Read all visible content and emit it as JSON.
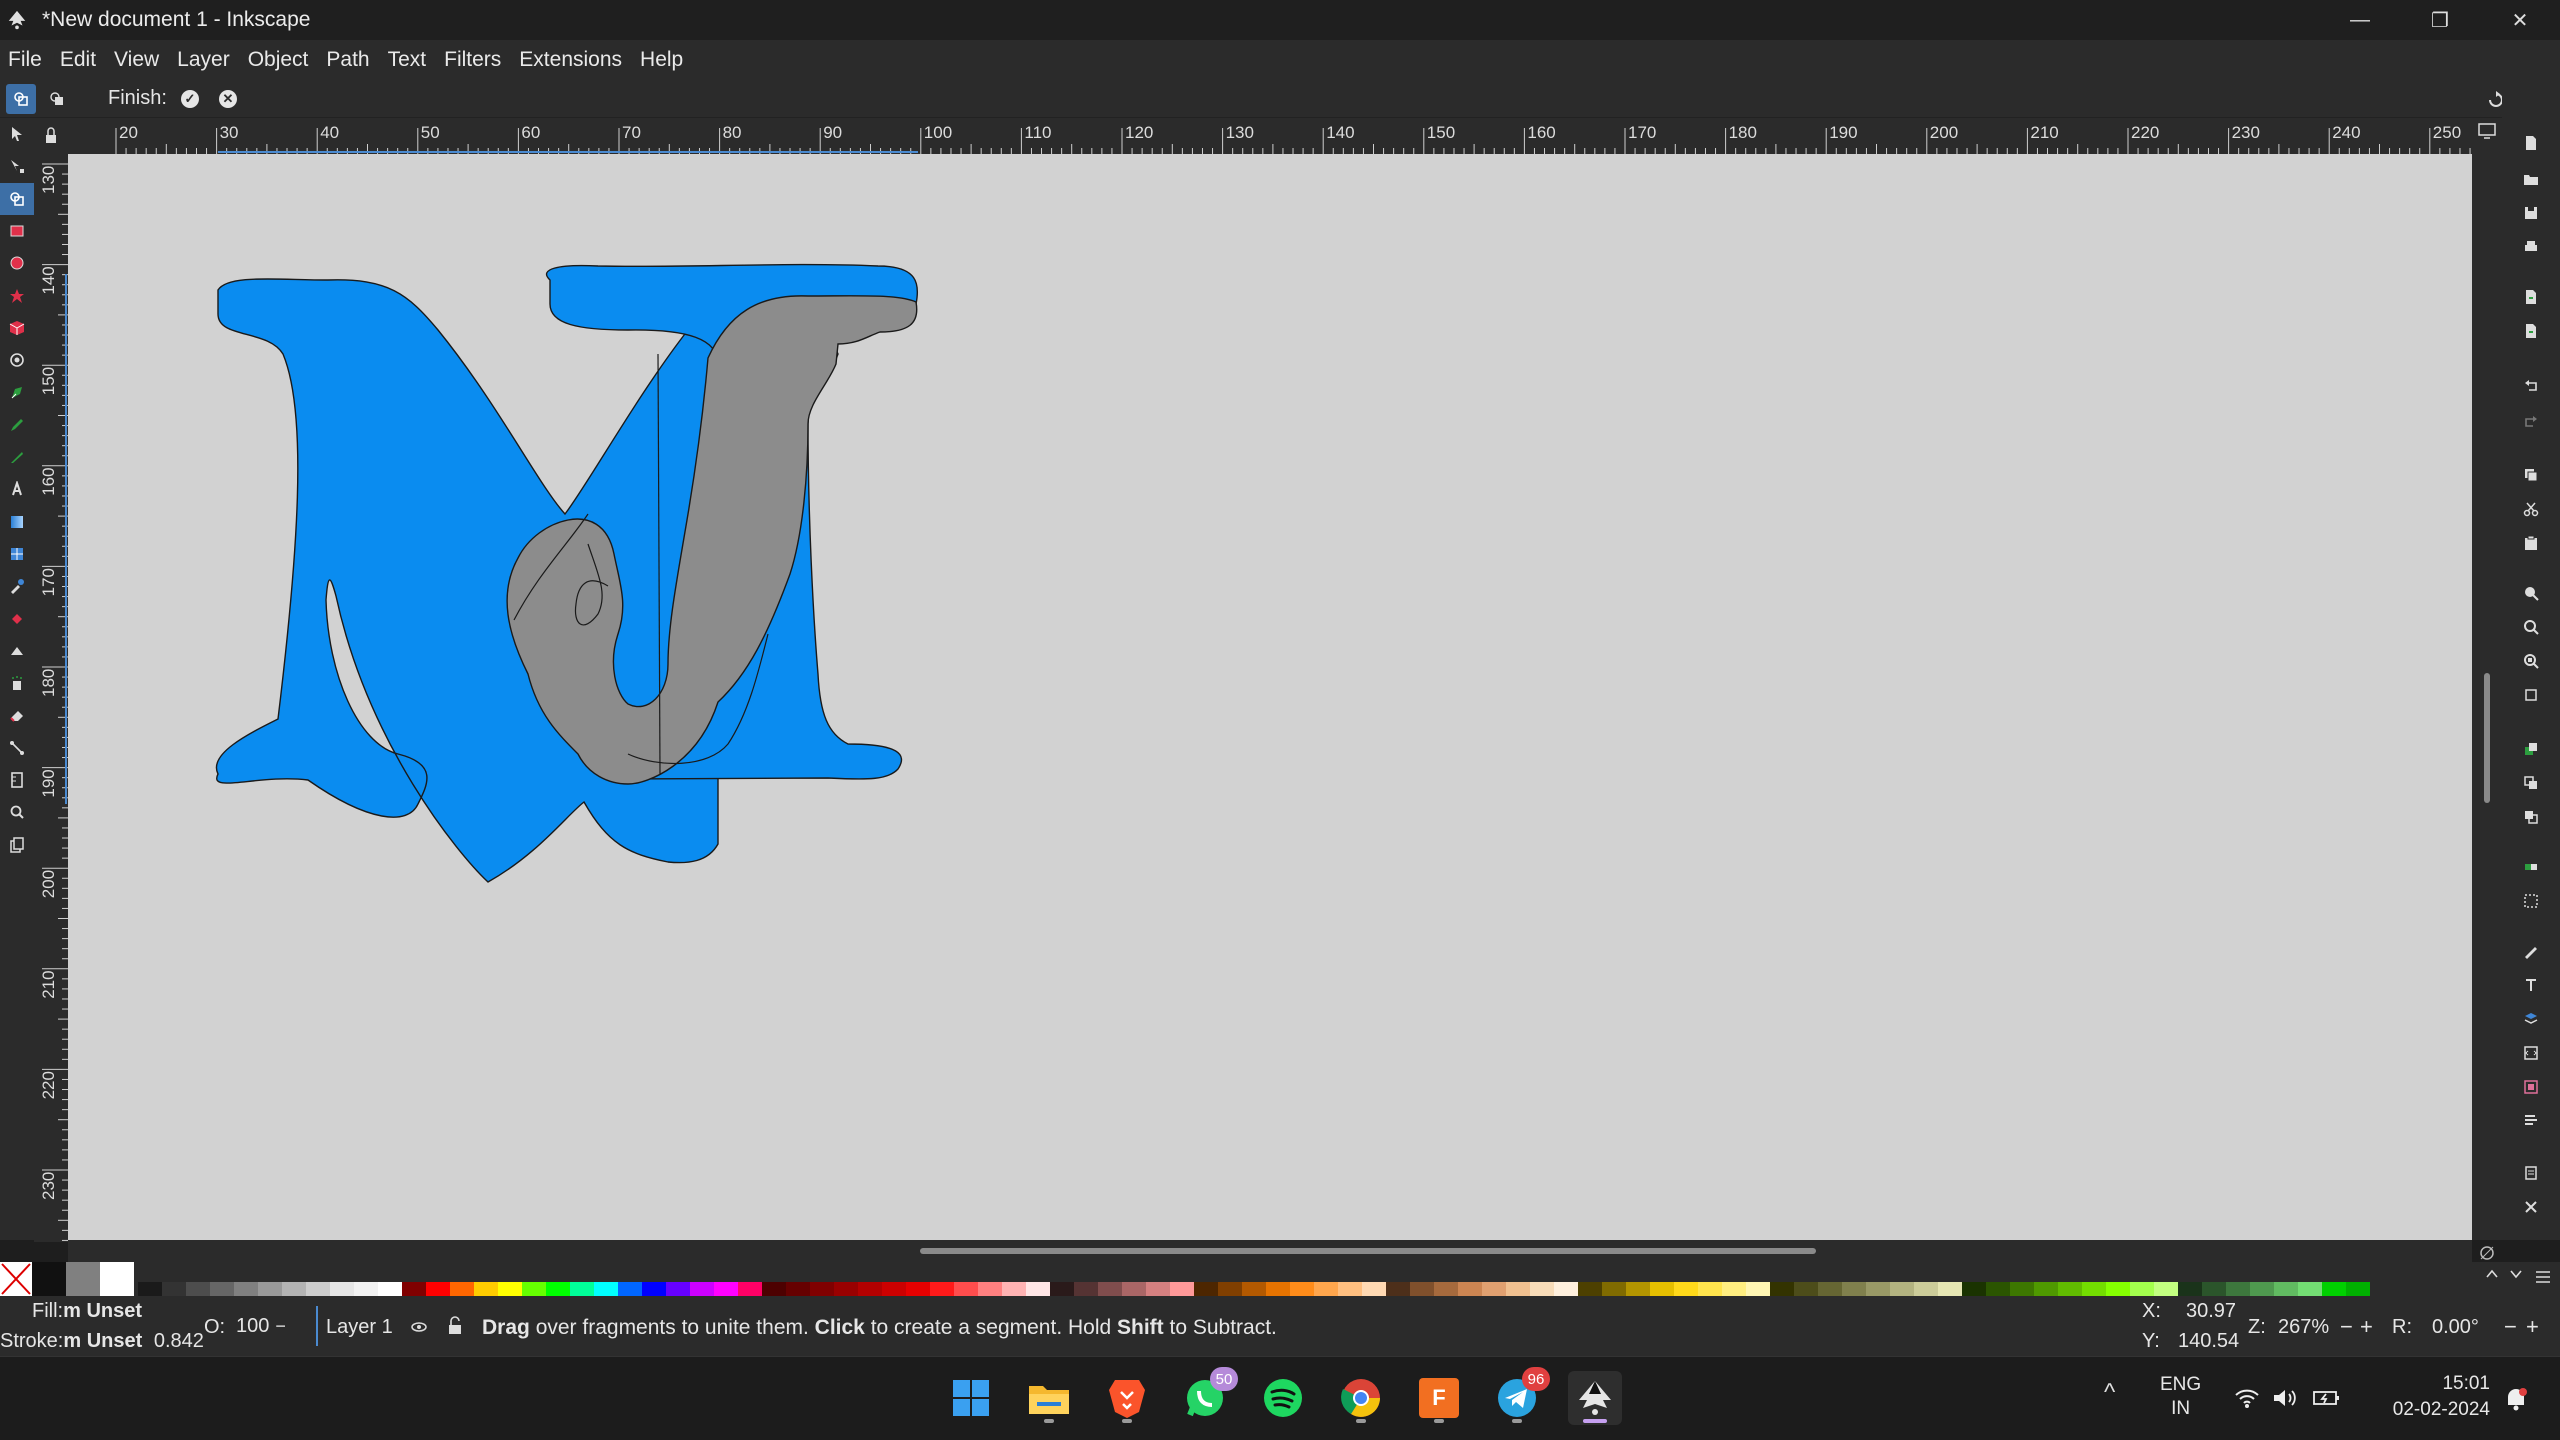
{
  "window": {
    "title": "*New document 1 - Inkscape",
    "minimize": "—",
    "restore": "❐",
    "close": "✕"
  },
  "menu": [
    "File",
    "Edit",
    "View",
    "Layer",
    "Object",
    "Path",
    "Text",
    "Filters",
    "Extensions",
    "Help"
  ],
  "tool_controls": {
    "finish_label": "Finish:",
    "apply_icon": "check-circle-icon",
    "cancel_icon": "cancel-circle-icon"
  },
  "toolbox": [
    "selector",
    "node",
    "shape-builder",
    "rectangle",
    "ellipse",
    "star",
    "3d-box",
    "spiral",
    "pen",
    "pencil",
    "calligraphy",
    "text",
    "gradient",
    "mesh",
    "dropper",
    "paint-bucket",
    "tweak",
    "spray",
    "eraser",
    "connector",
    "measure",
    "zoom",
    "pages"
  ],
  "rulers": {
    "horizontal_ticks": [
      "20",
      "30",
      "40",
      "50",
      "60",
      "70",
      "80",
      "90",
      "100",
      "110",
      "120",
      "130",
      "140",
      "150",
      "160",
      "170",
      "180",
      "190",
      "200",
      "210",
      "220",
      "230",
      "240",
      "250"
    ],
    "vertical_ticks": [
      "130",
      "140",
      "150",
      "160",
      "170",
      "180",
      "190",
      "200",
      "210",
      "220",
      "230"
    ]
  },
  "canvas": {
    "background": "#d2d2d2",
    "shape_colors": {
      "blue": "#0a8cf0",
      "gray": "#8c8c8c"
    }
  },
  "palette": {
    "colors": [
      "#1a1a1a",
      "#333333",
      "#4d4d4d",
      "#666666",
      "#808080",
      "#999999",
      "#b3b3b3",
      "#cccccc",
      "#e6e6e6",
      "#f2f2f2",
      "#ffffff",
      "#800000",
      "#ff0000",
      "#ff6600",
      "#ffcc00",
      "#ffff00",
      "#66ff00",
      "#00ff00",
      "#00ff99",
      "#00ffff",
      "#0066ff",
      "#0000ff",
      "#6600ff",
      "#cc00ff",
      "#ff00ff",
      "#ff0066",
      "#4d0000",
      "#660000",
      "#800000",
      "#990000",
      "#b30000",
      "#cc0000",
      "#e60000",
      "#ff1a1a",
      "#ff4d4d",
      "#ff8080",
      "#ffb3b3",
      "#ffe6e6",
      "#2a1a1a",
      "#553333",
      "#804d4d",
      "#aa6666",
      "#d58080",
      "#ff9999",
      "#4d2600",
      "#803f00",
      "#b35900",
      "#e67300",
      "#ff8c1a",
      "#ffa64d",
      "#ffbf80",
      "#ffd9b3",
      "#4d2f1a",
      "#80502c",
      "#a66a3d",
      "#cc8552",
      "#e0a070",
      "#f0c090",
      "#f8dcb8",
      "#fff0dd",
      "#4d4000",
      "#806b00",
      "#b39500",
      "#e6bf00",
      "#ffd91a",
      "#ffe44d",
      "#ffee80",
      "#fff6b3",
      "#333300",
      "#4d4d1a",
      "#666633",
      "#80804d",
      "#999966",
      "#b3b380",
      "#cccc99",
      "#e6e6b3",
      "#1a3300",
      "#2b5500",
      "#3d7700",
      "#4f9900",
      "#61bb00",
      "#73dd00",
      "#85ff00",
      "#a3ff4d",
      "#c2ff80",
      "#1a331a",
      "#2b552b",
      "#3d773d",
      "#4f994f",
      "#61bb61",
      "#73dd73",
      "#00d000",
      "#00b000"
    ],
    "fill_none": "#ffffff",
    "swatches_left": [
      "#111111",
      "#808080",
      "#ffffff"
    ]
  },
  "status": {
    "fill_label": "Fill:",
    "fill_value": "Unset",
    "fill_prefix": "m",
    "stroke_label": "Stroke:",
    "stroke_value": "Unset",
    "stroke_prefix": "m",
    "stroke_width": "0.842",
    "opacity_label": "O:",
    "opacity_value": "100",
    "layer": "Layer 1",
    "message_b1": "Drag",
    "message_t1": " over fragments to unite them. ",
    "message_b2": "Click",
    "message_t2": " to create a segment. Hold ",
    "message_b3": "Shift",
    "message_t3": " to Subtract.",
    "x_label": "X:",
    "x_value": "30.97",
    "y_label": "Y:",
    "y_value": "140.54",
    "zoom_label": "Z:",
    "zoom_value": "267%",
    "rotate_label": "R:",
    "rotate_value": "0.00°"
  },
  "taskbar": {
    "apps": [
      "windows-start",
      "file-explorer",
      "brave",
      "whatsapp",
      "spotify",
      "chrome",
      "fusion-360",
      "telegram",
      "inkscape"
    ],
    "whatsapp_badge": "50",
    "telegram_badge": "96",
    "fusion_label": "F",
    "language": "ENG",
    "region": "IN",
    "time": "15:01",
    "date": "02-02-2024",
    "chevron": "^"
  }
}
